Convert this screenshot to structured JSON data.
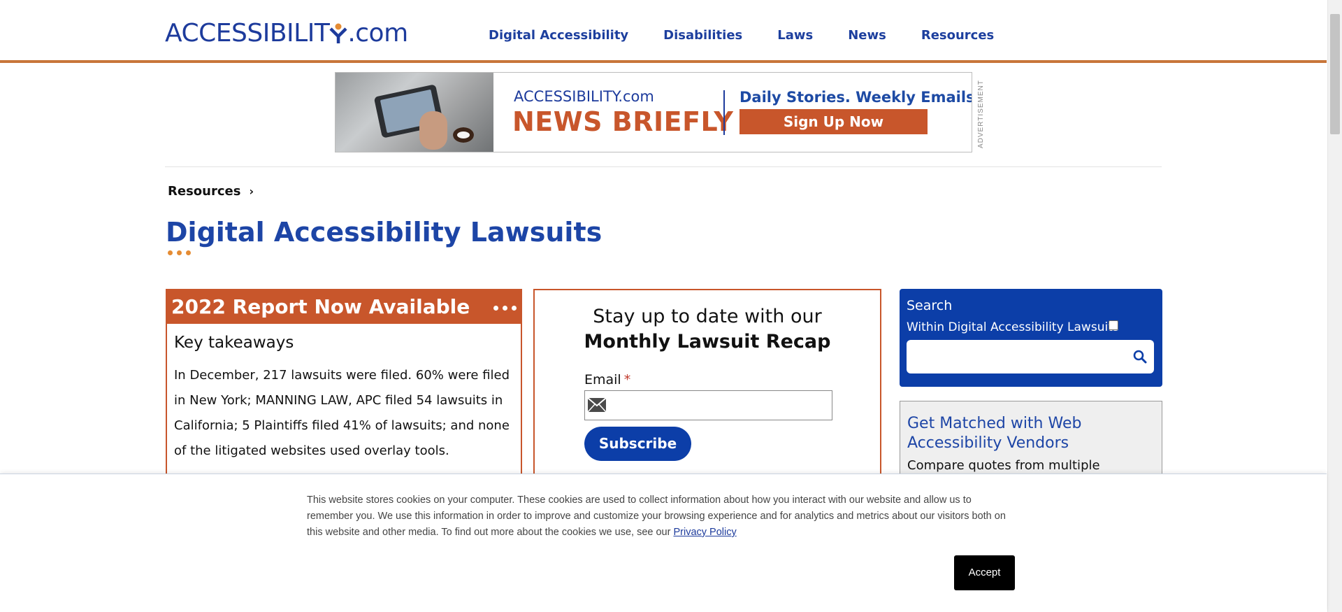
{
  "header": {
    "logo_prefix": "ACCESSIBILIT",
    "logo_suffix": ".com",
    "nav": [
      {
        "label": "Digital Accessibility"
      },
      {
        "label": "Disabilities"
      },
      {
        "label": "Laws"
      },
      {
        "label": "News"
      },
      {
        "label": "Resources"
      }
    ]
  },
  "ad": {
    "brand": "ACCESSIBILITY.com",
    "headline": "NEWS BRIEFLY",
    "tagline": "Daily Stories. Weekly Emails.",
    "cta": "Sign Up Now",
    "label": "ADVERTISEMENT"
  },
  "breadcrumb": {
    "label": "Resources",
    "chevron": "›"
  },
  "page_title": "Digital Accessibility Lawsuits",
  "report": {
    "title": "2022 Report Now Available",
    "subtitle": "Key takeaways",
    "body": "In December, 217 lawsuits were filed. 60% were filed in New York; MANNING LAW, APC filed 54 lawsuits in California; 5 Plaintiffs filed 41% of lawsuits; and none of the litigated websites used overlay tools."
  },
  "subscribe": {
    "line1": "Stay up to date with our",
    "line2": "Monthly Lawsuit Recap",
    "email_label": "Email",
    "required_mark": "*",
    "email_value": "",
    "button": "Subscribe"
  },
  "search": {
    "title": "Search",
    "within_label": "Within Digital Accessibility Lawsuits",
    "query": ""
  },
  "vendors": {
    "title": "Get Matched with Web Accessibility Vendors",
    "text": "Compare quotes from multiple"
  },
  "cookie": {
    "text": "This website stores cookies on your computer. These cookies are used to collect information about how you interact with our website and allow us to remember you. We use this information in order to improve and customize your browsing experience and for analytics and metrics about our visitors both on this website and other media. To find out more about the cookies we use, see our ",
    "link": "Privacy Policy",
    "accept": "Accept"
  },
  "colors": {
    "brand_blue": "#1d45a6",
    "accent_orange": "#c8562b",
    "button_blue": "#0c3ea8"
  }
}
